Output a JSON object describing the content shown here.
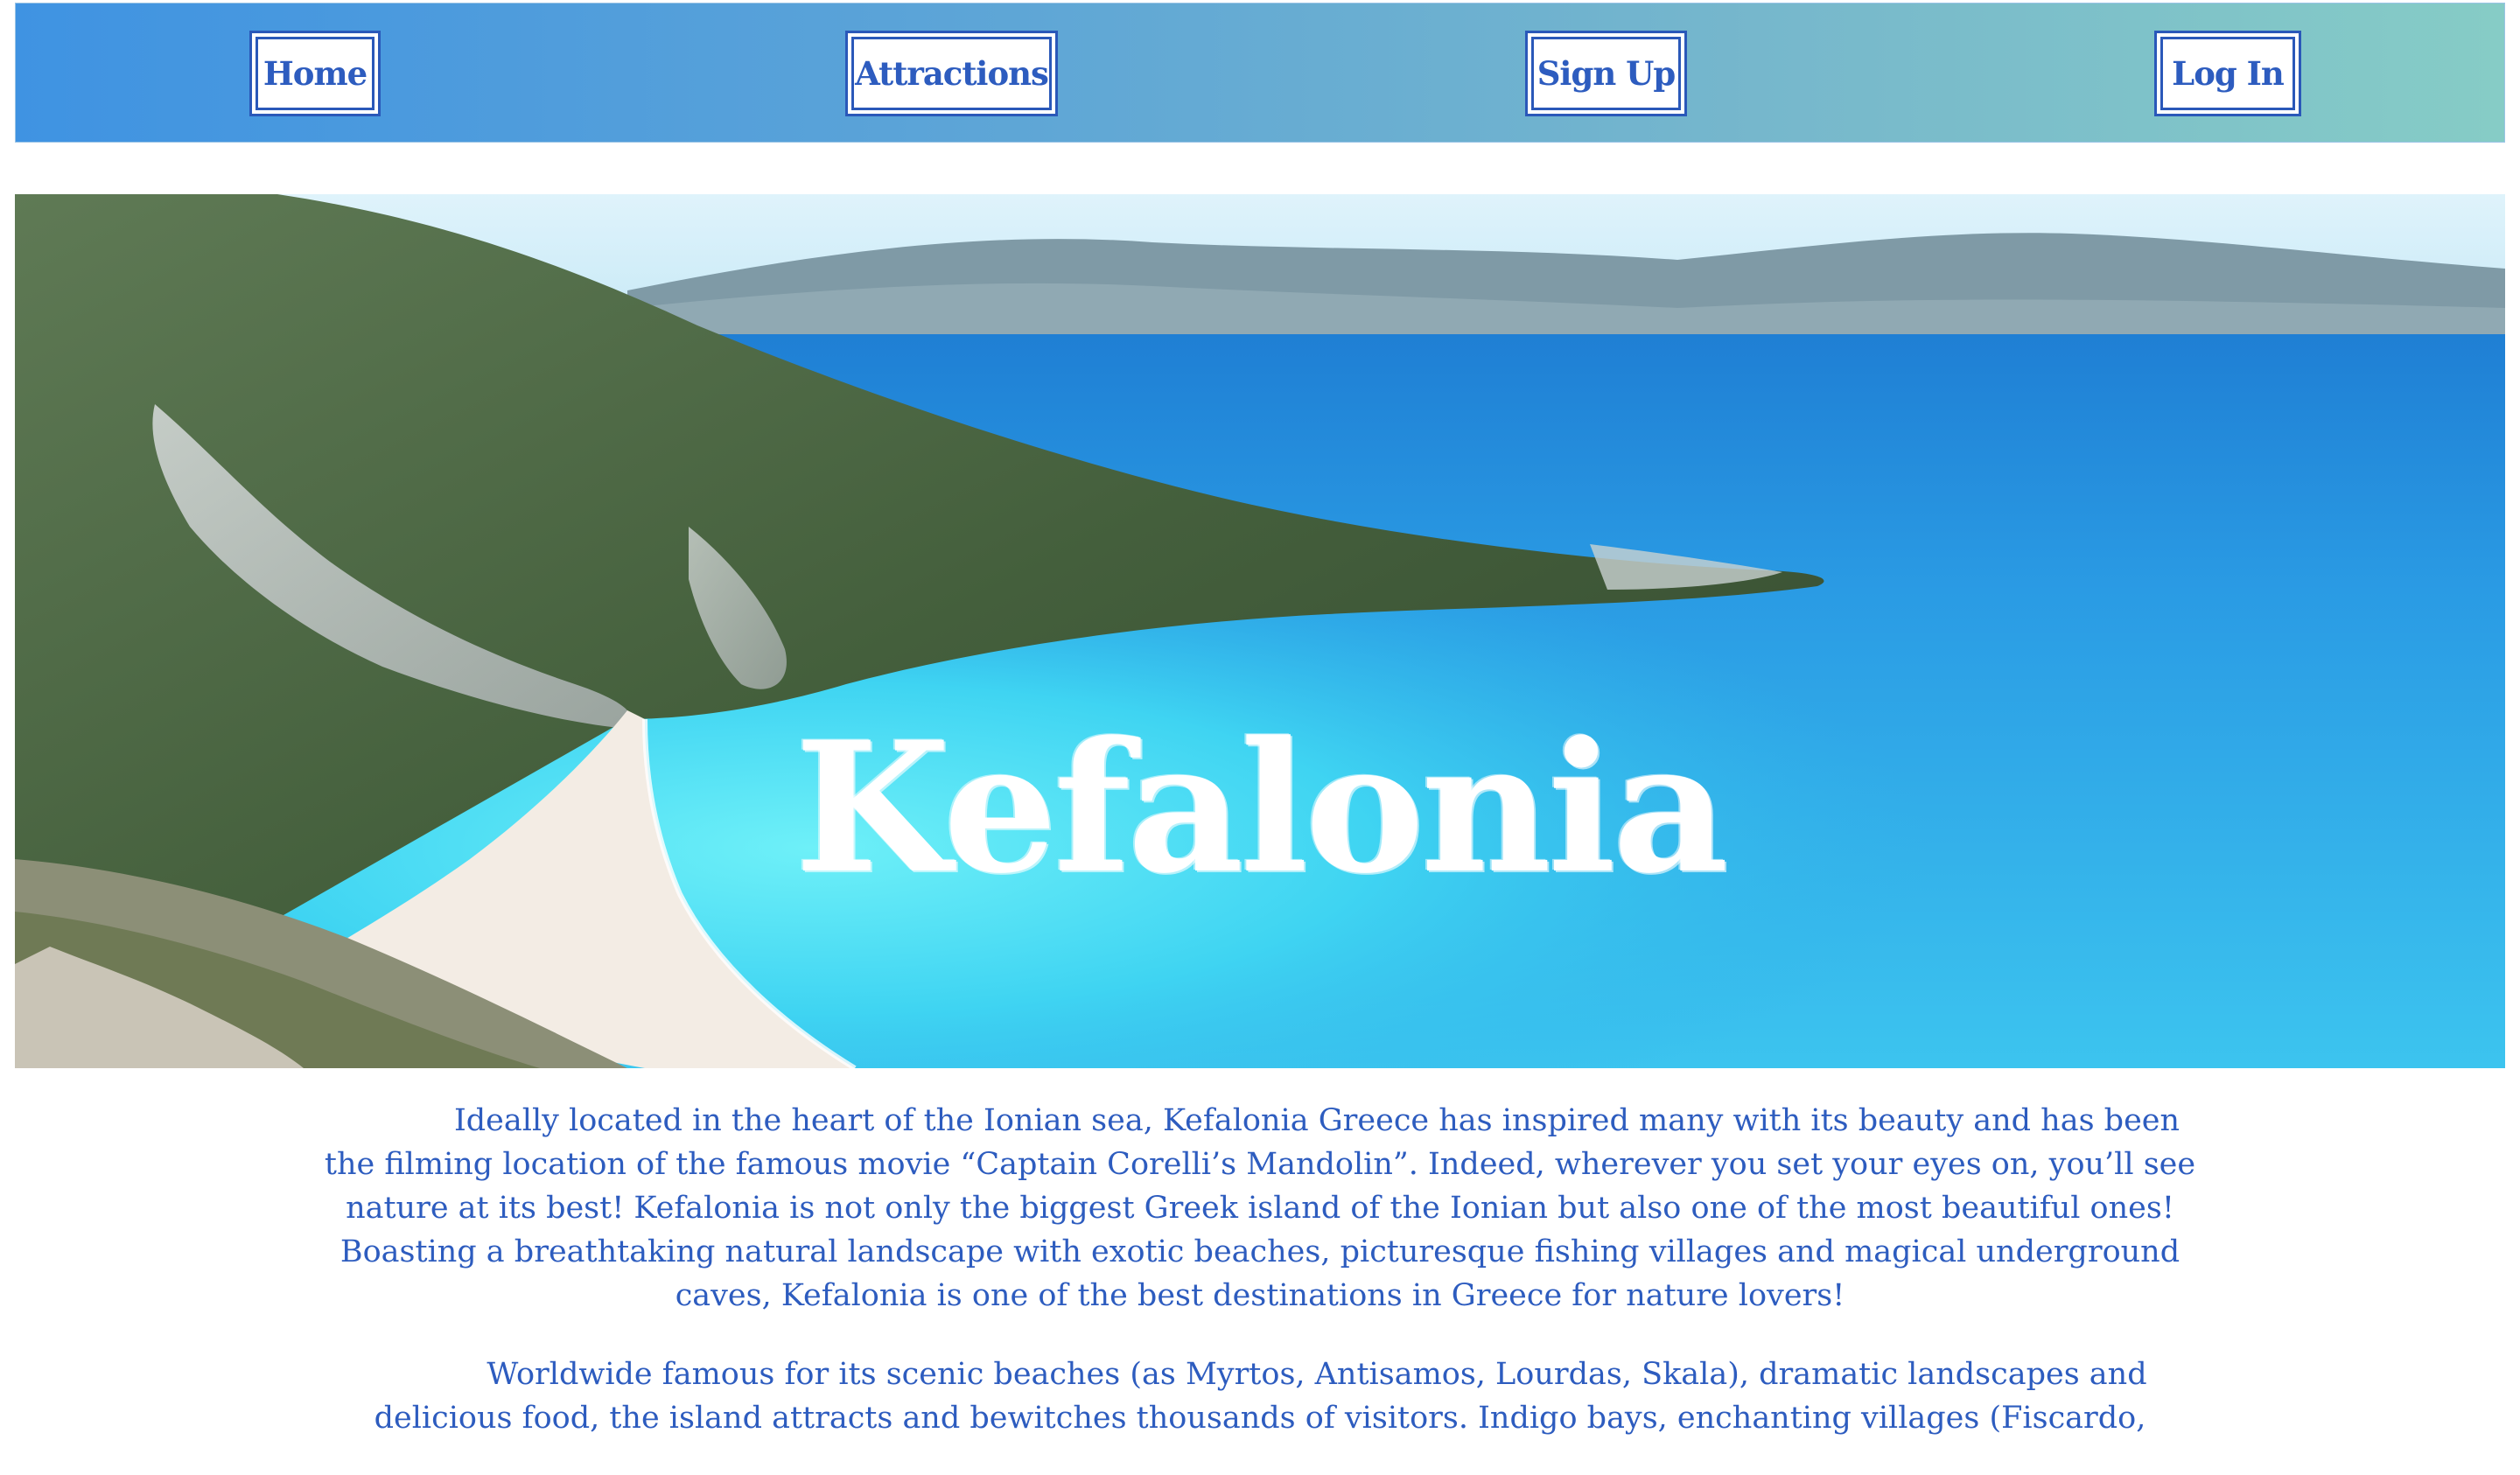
{
  "nav": {
    "home": "Home",
    "attractions": "Attractions",
    "signup": "Sign Up",
    "login": "Log In"
  },
  "hero": {
    "title": "Kefalonia"
  },
  "content": {
    "paragraphs": [
      "Ideally located in the heart of the Ionian sea, Kefalonia Greece has inspired many with its beauty and has been the filming location of the famous movie “Captain Corelli’s Mandolin”. Indeed, wherever you set your eyes on, you’ll see nature at its best! Kefalonia is not only the biggest Greek island of the Ionian but also one of the most beautiful ones! Boasting a breathtaking natural landscape with exotic beaches, picturesque fishing villages and magical underground caves, Kefalonia is one of the best destinations in Greece for nature lovers!",
      "Worldwide famous for its scenic beaches (as Myrtos, Antisamos, Lourdas, Skala), dramatic landscapes and delicious food, the island attracts and bewitches thousands of visitors. Indigo bays, enchanting villages (Fiscardo,"
    ]
  },
  "colors": {
    "link_text": "#2d5cbf",
    "nav_gradient_start": "#3f93e2",
    "nav_gradient_end": "#86ccc6",
    "sea": "#2fb6ea",
    "shallow_water": "#5fe0f3"
  }
}
